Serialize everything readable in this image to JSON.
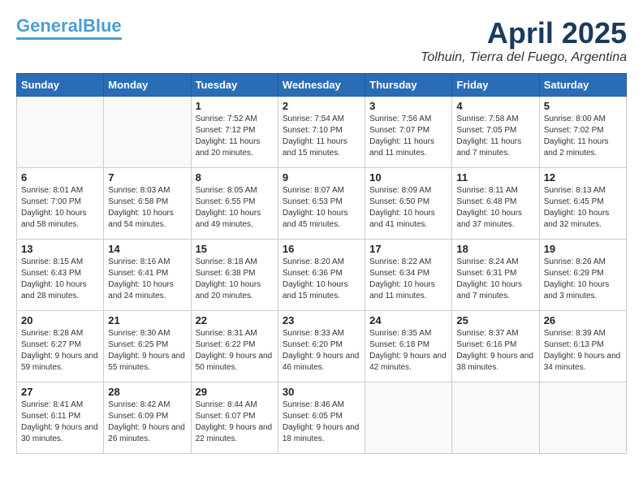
{
  "header": {
    "logo_line1": "General",
    "logo_line2": "Blue",
    "title": "April 2025",
    "subtitle": "Tolhuin, Tierra del Fuego, Argentina"
  },
  "weekdays": [
    "Sunday",
    "Monday",
    "Tuesday",
    "Wednesday",
    "Thursday",
    "Friday",
    "Saturday"
  ],
  "weeks": [
    [
      {
        "day": "",
        "info": ""
      },
      {
        "day": "",
        "info": ""
      },
      {
        "day": "1",
        "info": "Sunrise: 7:52 AM\nSunset: 7:12 PM\nDaylight: 11 hours\nand 20 minutes."
      },
      {
        "day": "2",
        "info": "Sunrise: 7:54 AM\nSunset: 7:10 PM\nDaylight: 11 hours\nand 15 minutes."
      },
      {
        "day": "3",
        "info": "Sunrise: 7:56 AM\nSunset: 7:07 PM\nDaylight: 11 hours\nand 11 minutes."
      },
      {
        "day": "4",
        "info": "Sunrise: 7:58 AM\nSunset: 7:05 PM\nDaylight: 11 hours\nand 7 minutes."
      },
      {
        "day": "5",
        "info": "Sunrise: 8:00 AM\nSunset: 7:02 PM\nDaylight: 11 hours\nand 2 minutes."
      }
    ],
    [
      {
        "day": "6",
        "info": "Sunrise: 8:01 AM\nSunset: 7:00 PM\nDaylight: 10 hours\nand 58 minutes."
      },
      {
        "day": "7",
        "info": "Sunrise: 8:03 AM\nSunset: 6:58 PM\nDaylight: 10 hours\nand 54 minutes."
      },
      {
        "day": "8",
        "info": "Sunrise: 8:05 AM\nSunset: 6:55 PM\nDaylight: 10 hours\nand 49 minutes."
      },
      {
        "day": "9",
        "info": "Sunrise: 8:07 AM\nSunset: 6:53 PM\nDaylight: 10 hours\nand 45 minutes."
      },
      {
        "day": "10",
        "info": "Sunrise: 8:09 AM\nSunset: 6:50 PM\nDaylight: 10 hours\nand 41 minutes."
      },
      {
        "day": "11",
        "info": "Sunrise: 8:11 AM\nSunset: 6:48 PM\nDaylight: 10 hours\nand 37 minutes."
      },
      {
        "day": "12",
        "info": "Sunrise: 8:13 AM\nSunset: 6:45 PM\nDaylight: 10 hours\nand 32 minutes."
      }
    ],
    [
      {
        "day": "13",
        "info": "Sunrise: 8:15 AM\nSunset: 6:43 PM\nDaylight: 10 hours\nand 28 minutes."
      },
      {
        "day": "14",
        "info": "Sunrise: 8:16 AM\nSunset: 6:41 PM\nDaylight: 10 hours\nand 24 minutes."
      },
      {
        "day": "15",
        "info": "Sunrise: 8:18 AM\nSunset: 6:38 PM\nDaylight: 10 hours\nand 20 minutes."
      },
      {
        "day": "16",
        "info": "Sunrise: 8:20 AM\nSunset: 6:36 PM\nDaylight: 10 hours\nand 15 minutes."
      },
      {
        "day": "17",
        "info": "Sunrise: 8:22 AM\nSunset: 6:34 PM\nDaylight: 10 hours\nand 11 minutes."
      },
      {
        "day": "18",
        "info": "Sunrise: 8:24 AM\nSunset: 6:31 PM\nDaylight: 10 hours\nand 7 minutes."
      },
      {
        "day": "19",
        "info": "Sunrise: 8:26 AM\nSunset: 6:29 PM\nDaylight: 10 hours\nand 3 minutes."
      }
    ],
    [
      {
        "day": "20",
        "info": "Sunrise: 8:28 AM\nSunset: 6:27 PM\nDaylight: 9 hours\nand 59 minutes."
      },
      {
        "day": "21",
        "info": "Sunrise: 8:30 AM\nSunset: 6:25 PM\nDaylight: 9 hours\nand 55 minutes."
      },
      {
        "day": "22",
        "info": "Sunrise: 8:31 AM\nSunset: 6:22 PM\nDaylight: 9 hours\nand 50 minutes."
      },
      {
        "day": "23",
        "info": "Sunrise: 8:33 AM\nSunset: 6:20 PM\nDaylight: 9 hours\nand 46 minutes."
      },
      {
        "day": "24",
        "info": "Sunrise: 8:35 AM\nSunset: 6:18 PM\nDaylight: 9 hours\nand 42 minutes."
      },
      {
        "day": "25",
        "info": "Sunrise: 8:37 AM\nSunset: 6:16 PM\nDaylight: 9 hours\nand 38 minutes."
      },
      {
        "day": "26",
        "info": "Sunrise: 8:39 AM\nSunset: 6:13 PM\nDaylight: 9 hours\nand 34 minutes."
      }
    ],
    [
      {
        "day": "27",
        "info": "Sunrise: 8:41 AM\nSunset: 6:11 PM\nDaylight: 9 hours\nand 30 minutes."
      },
      {
        "day": "28",
        "info": "Sunrise: 8:42 AM\nSunset: 6:09 PM\nDaylight: 9 hours\nand 26 minutes."
      },
      {
        "day": "29",
        "info": "Sunrise: 8:44 AM\nSunset: 6:07 PM\nDaylight: 9 hours\nand 22 minutes."
      },
      {
        "day": "30",
        "info": "Sunrise: 8:46 AM\nSunset: 6:05 PM\nDaylight: 9 hours\nand 18 minutes."
      },
      {
        "day": "",
        "info": ""
      },
      {
        "day": "",
        "info": ""
      },
      {
        "day": "",
        "info": ""
      }
    ]
  ]
}
